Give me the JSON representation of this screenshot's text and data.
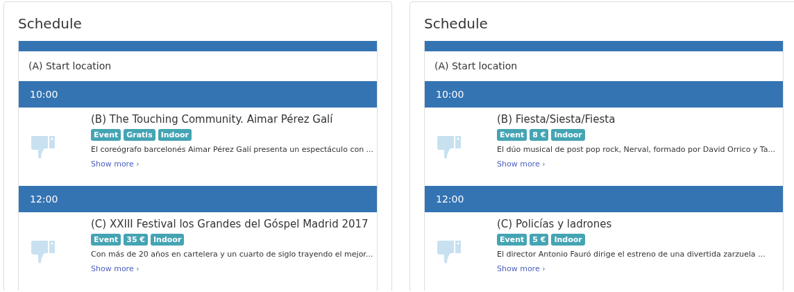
{
  "panels": [
    {
      "title": "Schedule",
      "start_location": "(A) Start location",
      "slots": [
        {
          "time": "10:00",
          "event": {
            "title": "(B) The Touching Community. Aimar Pérez Galí",
            "tags": [
              "Event",
              "Gratis",
              "Indoor"
            ],
            "description": "El coreógrafo barcelonés Aimar Pérez Galí presenta un espectáculo con ...",
            "link": "Show more ›"
          }
        },
        {
          "time": "12:00",
          "event": {
            "title": "(C) XXIII Festival los Grandes del Góspel Madrid 2017",
            "tags": [
              "Event",
              "35 €",
              "Indoor"
            ],
            "description": "Con más de 20 años en cartelera y un cuarto de siglo trayendo el mejor...",
            "link": "Show more ›"
          }
        }
      ]
    },
    {
      "title": "Schedule",
      "start_location": "(A) Start location",
      "slots": [
        {
          "time": "10:00",
          "event": {
            "title": "(B) Fiesta/Siesta/Fiesta",
            "tags": [
              "Event",
              "8 €",
              "Indoor"
            ],
            "description": "El dúo musical de post pop rock, Nerval, formado por David Orrico y Ta...",
            "link": "Show more ›"
          }
        },
        {
          "time": "12:00",
          "event": {
            "title": "(C) Policías y ladrones",
            "tags": [
              "Event",
              "5 €",
              "Indoor"
            ],
            "description": "El director Antonio Fauró dirige el estreno de una divertida zarzuela ...",
            "link": "Show more ›"
          }
        }
      ]
    }
  ]
}
